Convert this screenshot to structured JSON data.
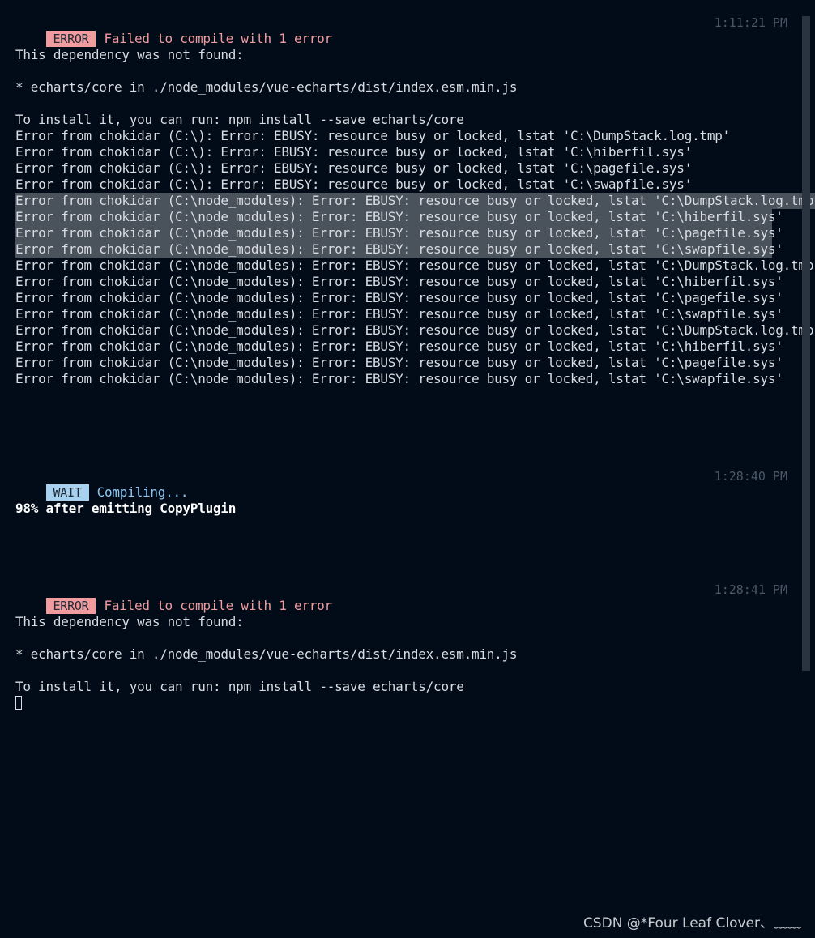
{
  "blocks": {
    "error1": {
      "badge": "ERROR",
      "message": "Failed to compile with 1 error",
      "time": "1:11:21 PM"
    },
    "wait": {
      "badge": "WAIT",
      "message": "Compiling...",
      "time": "1:28:40 PM",
      "progress": "98% after emitting CopyPlugin"
    },
    "error2": {
      "badge": "ERROR",
      "message": "Failed to compile with 1 error",
      "time": "1:28:41 PM"
    }
  },
  "lines1": {
    "dep_not_found": "This dependency was not found:",
    "dep_item": "* echarts/core in ./node_modules/vue-echarts/dist/index.esm.min.js",
    "install_hint": "To install it, you can run: npm install --save echarts/core"
  },
  "chokidar": [
    "Error from chokidar (C:\\): Error: EBUSY: resource busy or locked, lstat 'C:\\DumpStack.log.tmp'",
    "Error from chokidar (C:\\): Error: EBUSY: resource busy or locked, lstat 'C:\\hiberfil.sys'",
    "Error from chokidar (C:\\): Error: EBUSY: resource busy or locked, lstat 'C:\\pagefile.sys'",
    "Error from chokidar (C:\\): Error: EBUSY: resource busy or locked, lstat 'C:\\swapfile.sys'",
    "Error from chokidar (C:\\node_modules): Error: EBUSY: resource busy or locked, lstat 'C:\\DumpStack.log.tmp'",
    "Error from chokidar (C:\\node_modules): Error: EBUSY: resource busy or locked, lstat 'C:\\hiberfil.sys'",
    "Error from chokidar (C:\\node_modules): Error: EBUSY: resource busy or locked, lstat 'C:\\pagefile.sys'",
    "Error from chokidar (C:\\node_modules): Error: EBUSY: resource busy or locked, lstat 'C:\\swapfile.sys'",
    "Error from chokidar (C:\\node_modules): Error: EBUSY: resource busy or locked, lstat 'C:\\DumpStack.log.tmp'",
    "Error from chokidar (C:\\node_modules): Error: EBUSY: resource busy or locked, lstat 'C:\\hiberfil.sys'",
    "Error from chokidar (C:\\node_modules): Error: EBUSY: resource busy or locked, lstat 'C:\\pagefile.sys'",
    "Error from chokidar (C:\\node_modules): Error: EBUSY: resource busy or locked, lstat 'C:\\swapfile.sys'",
    "Error from chokidar (C:\\node_modules): Error: EBUSY: resource busy or locked, lstat 'C:\\DumpStack.log.tmp'",
    "Error from chokidar (C:\\node_modules): Error: EBUSY: resource busy or locked, lstat 'C:\\hiberfil.sys'",
    "Error from chokidar (C:\\node_modules): Error: EBUSY: resource busy or locked, lstat 'C:\\pagefile.sys'",
    "Error from chokidar (C:\\node_modules): Error: EBUSY: resource busy or locked, lstat 'C:\\swapfile.sys'"
  ],
  "lines2": {
    "dep_not_found": "This dependency was not found:",
    "dep_item": "* echarts/core in ./node_modules/vue-echarts/dist/index.esm.min.js",
    "install_hint": "To install it, you can run: npm install --save echarts/core"
  },
  "watermark": "CSDN @*Four Leaf Clover、﹏﹏",
  "colors": {
    "background": "#020c18",
    "text": "#d9dde3",
    "error": "#f29b9e",
    "wait": "#8ec7f3",
    "selection": "#4a525c",
    "timestamp": "#4a5866"
  },
  "icons": {
    "cursor": "block-cursor"
  }
}
